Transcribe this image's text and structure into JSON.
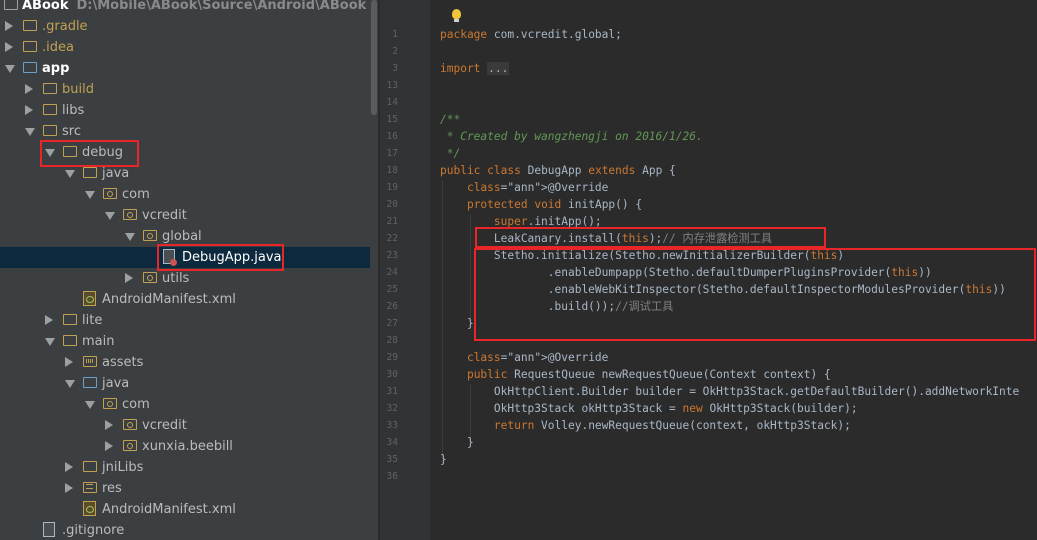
{
  "project": {
    "root_name": "ABook",
    "root_path": "D:\\Mobile\\ABook\\Source\\Android\\ABook"
  },
  "tree": [
    {
      "label": ".gradle",
      "indent": 0,
      "arrow": "right",
      "icon": "folder-icon",
      "color": "#c1a151"
    },
    {
      "label": ".idea",
      "indent": 0,
      "arrow": "right",
      "icon": "folder-icon",
      "color": "#c1a151"
    },
    {
      "label": "app",
      "indent": 0,
      "arrow": "down",
      "icon": "module-folder-icon",
      "color": "#ffffff"
    },
    {
      "label": "build",
      "indent": 1,
      "arrow": "right",
      "icon": "folder-icon",
      "color": "#c1a151"
    },
    {
      "label": "libs",
      "indent": 1,
      "arrow": "right",
      "icon": "folder-icon"
    },
    {
      "label": "src",
      "indent": 1,
      "arrow": "down",
      "icon": "folder-icon"
    },
    {
      "label": "debug",
      "indent": 2,
      "arrow": "down",
      "icon": "folder-icon"
    },
    {
      "label": "java",
      "indent": 3,
      "arrow": "down",
      "icon": "folder-icon"
    },
    {
      "label": "com",
      "indent": 4,
      "arrow": "down",
      "icon": "package-icon"
    },
    {
      "label": "vcredit",
      "indent": 5,
      "arrow": "down",
      "icon": "package-icon"
    },
    {
      "label": "global",
      "indent": 6,
      "arrow": "down",
      "icon": "package-icon"
    },
    {
      "label": "DebugApp.java",
      "indent": 7,
      "arrow": "none",
      "icon": "java-file-icon"
    },
    {
      "label": "utils",
      "indent": 6,
      "arrow": "right",
      "icon": "package-icon"
    },
    {
      "label": "AndroidManifest.xml",
      "indent": 3,
      "arrow": "none",
      "icon": "xml-file-icon"
    },
    {
      "label": "lite",
      "indent": 2,
      "arrow": "right",
      "icon": "folder-icon"
    },
    {
      "label": "main",
      "indent": 2,
      "arrow": "down",
      "icon": "folder-icon"
    },
    {
      "label": "assets",
      "indent": 3,
      "arrow": "right",
      "icon": "assets-folder-icon"
    },
    {
      "label": "java",
      "indent": 3,
      "arrow": "down",
      "icon": "source-folder-icon"
    },
    {
      "label": "com",
      "indent": 4,
      "arrow": "down",
      "icon": "package-icon"
    },
    {
      "label": "vcredit",
      "indent": 5,
      "arrow": "right",
      "icon": "package-icon"
    },
    {
      "label": "xunxia.beebill",
      "indent": 5,
      "arrow": "right",
      "icon": "package-icon"
    },
    {
      "label": "jniLibs",
      "indent": 3,
      "arrow": "right",
      "icon": "folder-icon"
    },
    {
      "label": "res",
      "indent": 3,
      "arrow": "right",
      "icon": "res-folder-icon"
    },
    {
      "label": "AndroidManifest.xml",
      "indent": 3,
      "arrow": "none",
      "icon": "xml-file-icon"
    },
    {
      "label": ".gitignore",
      "indent": 1,
      "arrow": "none",
      "icon": "text-file-icon"
    }
  ],
  "line_numbers": [
    "1",
    "2",
    "3",
    "13",
    "14",
    "15",
    "16",
    "17",
    "18",
    "19",
    "20",
    "21",
    "22",
    "23",
    "24",
    "25",
    "26",
    "27",
    "28",
    "29",
    "30",
    "31",
    "32",
    "33",
    "34",
    "35",
    "36"
  ],
  "code_lines": [
    "package com.vcredit.global;",
    "",
    "import ...",
    "",
    "",
    "/**",
    " * Created by wangzhengji on 2016/1/26.",
    " */",
    "public class DebugApp extends App {",
    "    @Override",
    "    protected void initApp() {",
    "        super.initApp();",
    "        LeakCanary.install(this);// 内存泄露检测工具",
    "        Stetho.initialize(Stetho.newInitializerBuilder(this)",
    "                .enableDumpapp(Stetho.defaultDumperPluginsProvider(this))",
    "                .enableWebKitInspector(Stetho.defaultInspectorModulesProvider(this))",
    "                .build());//调试工具",
    "    }",
    "",
    "    @Override",
    "    public RequestQueue newRequestQueue(Context context) {",
    "        OkHttpClient.Builder builder = OkHttp3Stack.getDefaultBuilder().addNetworkInte",
    "        OkHttp3Stack okHttp3Stack = new OkHttp3Stack(builder);",
    "        return Volley.newRequestQueue(context, okHttp3Stack);",
    "    }",
    "}",
    ""
  ]
}
